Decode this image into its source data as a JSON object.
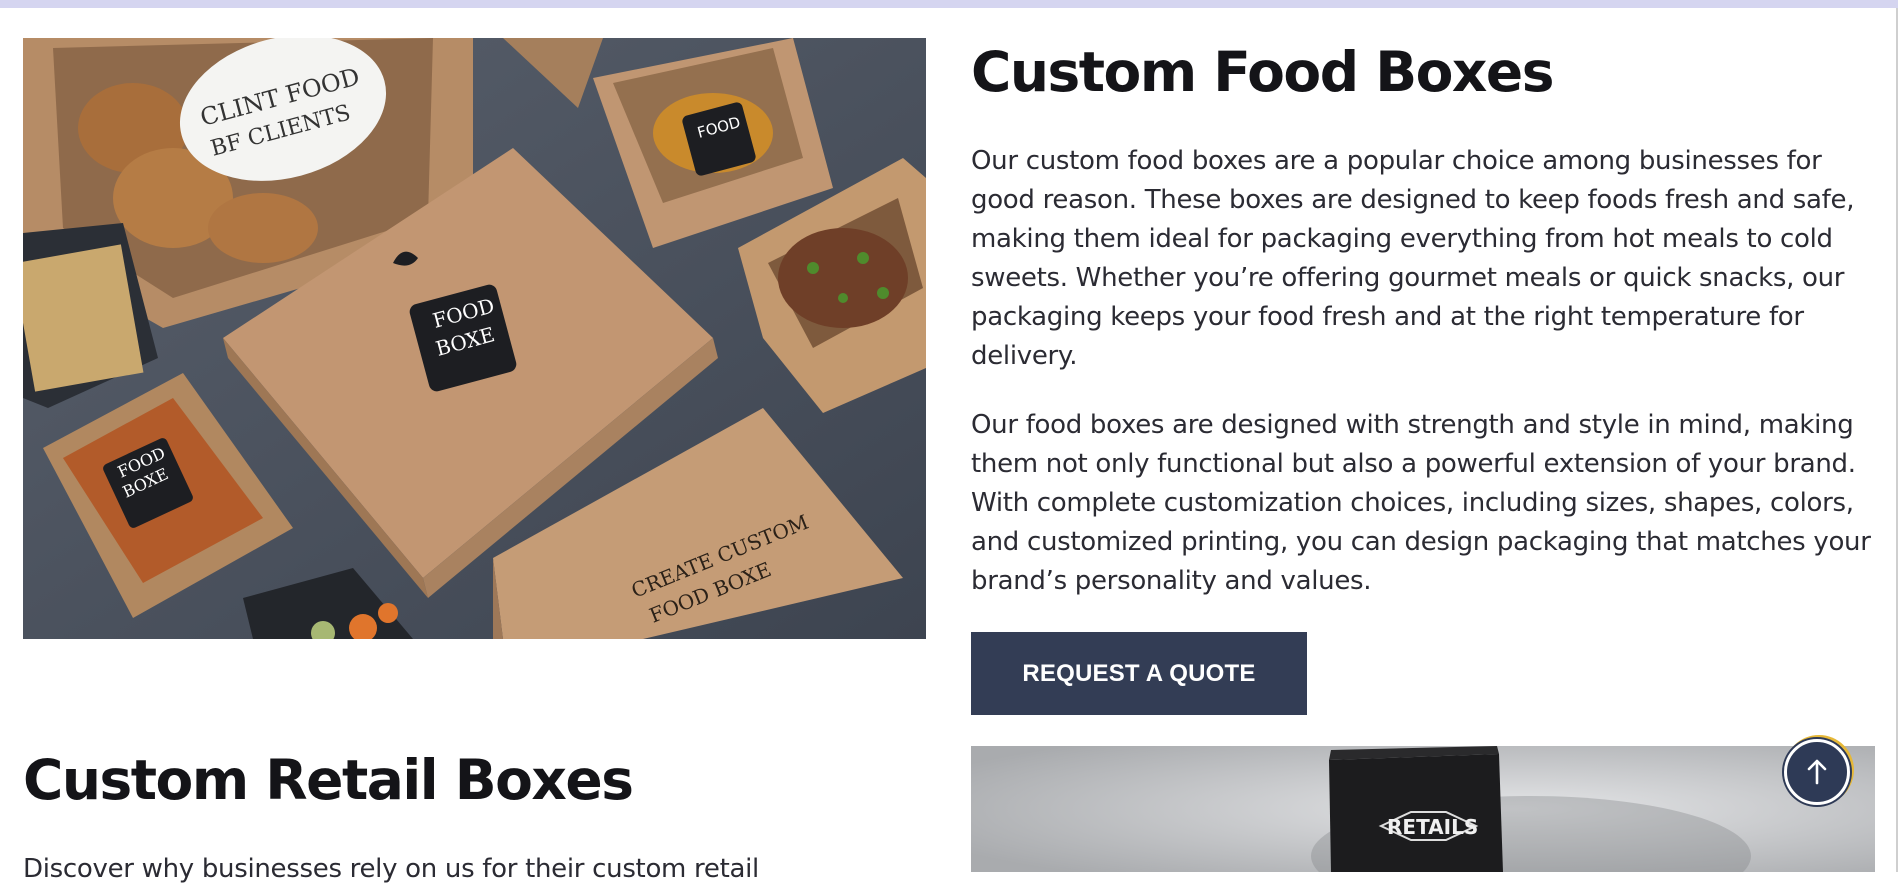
{
  "food_section": {
    "title": "Custom Food Boxes",
    "paragraphs": [
      "Our custom food boxes are a popular choice among businesses for good reason. These boxes are designed to keep foods fresh and safe, making them ideal for packaging everything from hot meals to cold sweets. Whether you’re offering gourmet meals or quick snacks, our packaging keeps your food fresh and at the right temperature for delivery.",
      "Our food boxes are designed with strength and style in mind, making them not only functional but also a powerful extension of your brand. With complete customization choices, including sizes, shapes, colors, and customized printing, you can design packaging that matches your brand’s personality and values."
    ],
    "cta_label": "REQUEST A QUOTE",
    "image_text": {
      "plate": "CLINT FOOD",
      "plate2": "BF CLIENTS",
      "label1": "FOOD",
      "label2": "BOXE",
      "small_label1": "FOOD",
      "small_label2": "BOXE",
      "lid1": "CREATE CUSTOM",
      "lid2": "FOOD BOXE",
      "corner1": "FOOD",
      "corner2": "FOOD"
    }
  },
  "retail_section": {
    "title": "Custom Retail Boxes",
    "intro": "Discover why businesses rely on us for their custom retail",
    "image_text": {
      "label": "RETAILS"
    }
  },
  "colors": {
    "accent": "#333d55",
    "top_bar": "#d5d5f0",
    "scroll_ring": "#e6b838"
  },
  "icons": {
    "scroll_to_top": "arrow-up-icon"
  }
}
